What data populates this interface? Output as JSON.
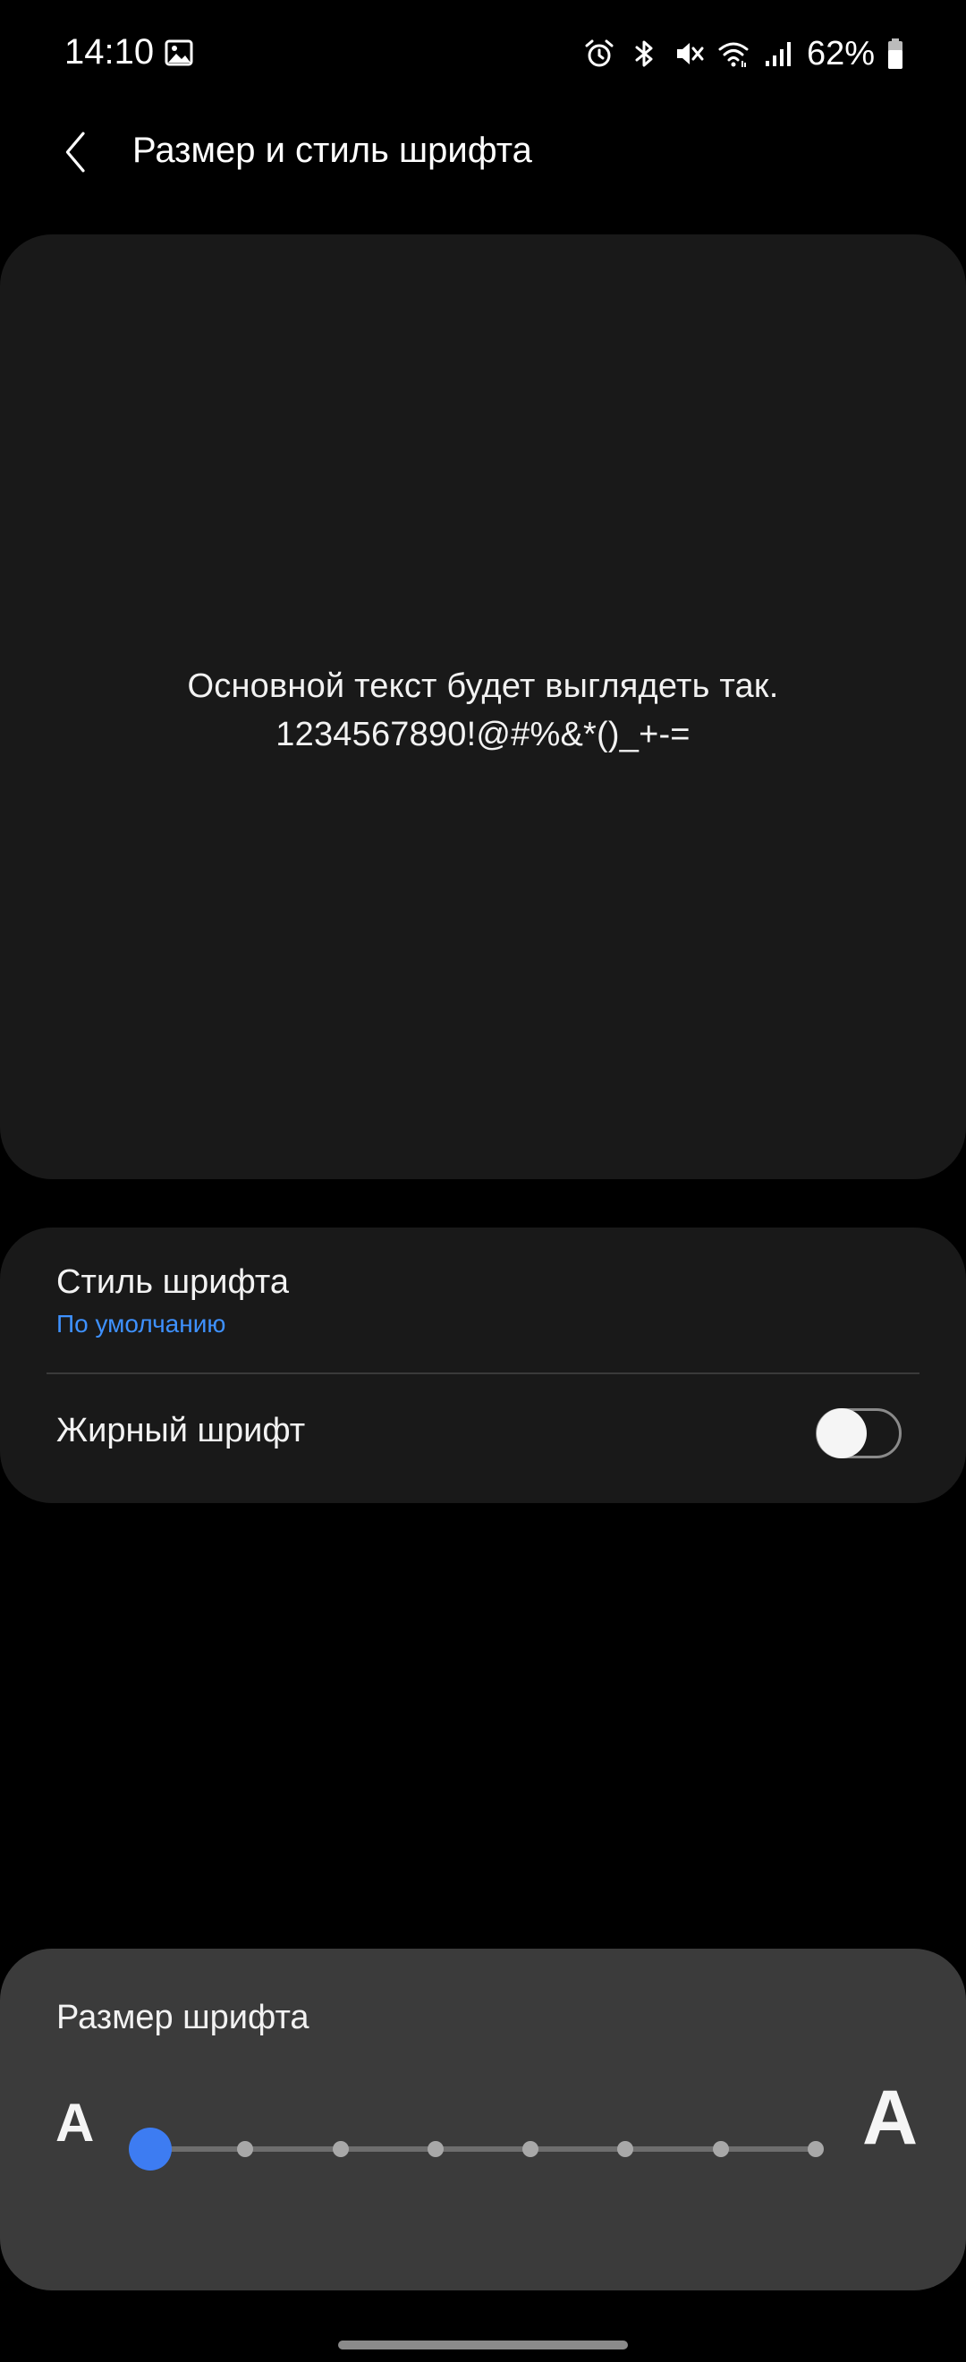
{
  "status_bar": {
    "time": "14:10",
    "battery_percent": "62%",
    "icons": [
      "gallery-icon",
      "alarm-icon",
      "bluetooth-icon",
      "mute-icon",
      "wifi-icon",
      "signal-icon",
      "battery-icon"
    ]
  },
  "header": {
    "back_icon": "chevron-left-icon",
    "title": "Размер и стиль шрифта"
  },
  "preview": {
    "line1": "Основной текст будет выглядеть так.",
    "line2": "1234567890!@#%&*()_+-="
  },
  "settings": {
    "font_style": {
      "title": "Стиль шрифта",
      "value": "По умолчанию"
    },
    "bold_font": {
      "title": "Жирный шрифт",
      "enabled": false
    }
  },
  "font_size": {
    "title": "Размер шрифта",
    "small_label": "A",
    "large_label": "A",
    "steps": 8,
    "selected_step": 1
  },
  "colors": {
    "background": "#000000",
    "card": "#191919",
    "panel": "#3b3b3b",
    "accent": "#3d7cf2",
    "link": "#3e91ff"
  }
}
